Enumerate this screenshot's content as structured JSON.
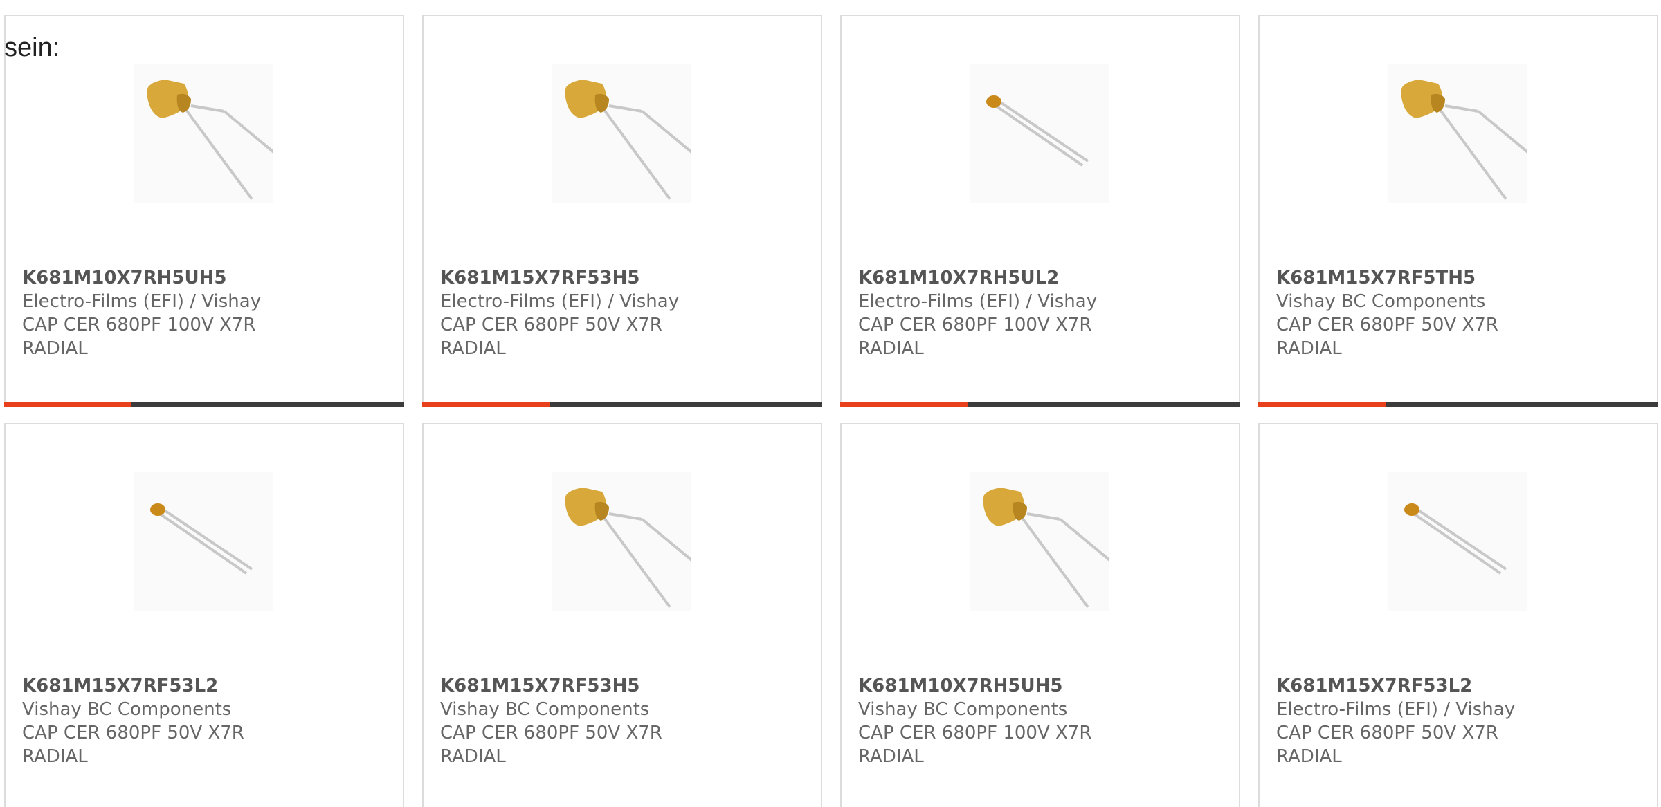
{
  "intro_text": "sein:",
  "colors": {
    "accent": "#e8401c",
    "bar_dark": "#3c3c3c",
    "card_border": "#dcdcdc",
    "capacitor_body": "#d8a93a"
  },
  "products": [
    {
      "part_number": "K681M10X7RH5UH5",
      "manufacturer": "Electro-Films (EFI) / Vishay",
      "description": "CAP CER 680PF 100V X7R RADIAL",
      "image_icon": "large-radial-capacitor-icon"
    },
    {
      "part_number": "K681M15X7RF53H5",
      "manufacturer": "Electro-Films (EFI) / Vishay",
      "description": "CAP CER 680PF 50V X7R RADIAL",
      "image_icon": "large-radial-capacitor-icon"
    },
    {
      "part_number": "K681M10X7RH5UL2",
      "manufacturer": "Electro-Films (EFI) / Vishay",
      "description": "CAP CER 680PF 100V X7R RADIAL",
      "image_icon": "small-radial-capacitor-icon"
    },
    {
      "part_number": "K681M15X7RF5TH5",
      "manufacturer": "Vishay BC Components",
      "description": "CAP CER 680PF 50V X7R RADIAL",
      "image_icon": "large-radial-capacitor-icon"
    },
    {
      "part_number": "K681M15X7RF53L2",
      "manufacturer": "Vishay BC Components",
      "description": "CAP CER 680PF 50V X7R RADIAL",
      "image_icon": "small-radial-capacitor-icon"
    },
    {
      "part_number": "K681M15X7RF53H5",
      "manufacturer": "Vishay BC Components",
      "description": "CAP CER 680PF 50V X7R RADIAL",
      "image_icon": "large-radial-capacitor-icon"
    },
    {
      "part_number": "K681M10X7RH5UH5",
      "manufacturer": "Vishay BC Components",
      "description": "CAP CER 680PF 100V X7R RADIAL",
      "image_icon": "large-radial-capacitor-icon"
    },
    {
      "part_number": "K681M15X7RF53L2",
      "manufacturer": "Electro-Films (EFI) / Vishay",
      "description": "CAP CER 680PF 50V X7R RADIAL",
      "image_icon": "small-radial-capacitor-icon"
    }
  ]
}
